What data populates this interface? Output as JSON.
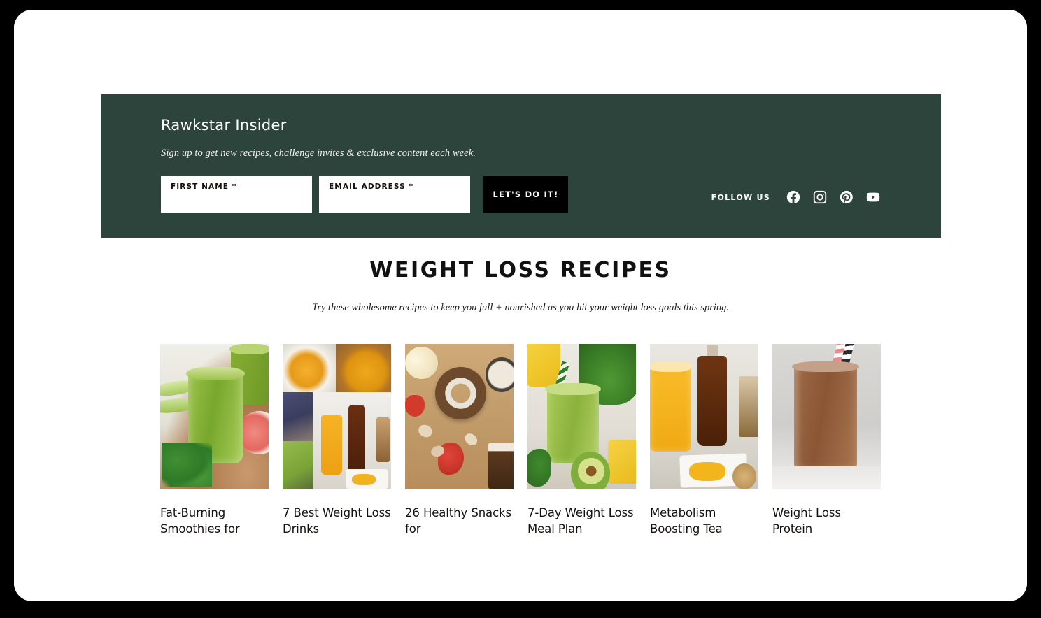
{
  "newsletter": {
    "title": "Rawkstar Insider",
    "subtitle": "Sign up to get new recipes, challenge invites & exclusive content each week.",
    "first_name_label": "FIRST NAME *",
    "first_name_value": "",
    "first_name_placeholder": "",
    "email_label": "EMAIL ADDRESS *",
    "email_value": "",
    "email_placeholder": "",
    "submit_label": "LET'S DO IT!",
    "background_color": "#2d443d",
    "button_color": "#000000"
  },
  "follow": {
    "label": "FOLLOW US",
    "socials": [
      {
        "name": "facebook-icon",
        "label": "Facebook"
      },
      {
        "name": "instagram-icon",
        "label": "Instagram"
      },
      {
        "name": "pinterest-icon",
        "label": "Pinterest"
      },
      {
        "name": "youtube-icon",
        "label": "YouTube"
      }
    ]
  },
  "recipes": {
    "heading": "WEIGHT LOSS RECIPES",
    "subheading": "Try these wholesome recipes to keep you full + nourished as you hit your weight loss goals this spring.",
    "cards": [
      {
        "title": "Fat-Burning Smoothies for",
        "image_alt": "green smoothie in mason jars with mint, celery and grapefruit"
      },
      {
        "title": "7 Best Weight Loss Drinks",
        "image_alt": "collage of turmeric drinks, blueberry smoothie and green smoothie"
      },
      {
        "title": "26 Healthy Snacks for",
        "image_alt": "coconut donut, strawberries and almonds on a wooden board"
      },
      {
        "title": "7-Day Weight Loss Meal Plan",
        "image_alt": "green smoothie with spinach, pineapple and avocado"
      },
      {
        "title": "Metabolism Boosting Tea",
        "image_alt": "jars of turmeric tea and dark brewed tea with fresh ginger"
      },
      {
        "title": "Weight Loss Protein",
        "image_alt": "chocolate protein shake in a glass with striped straws"
      }
    ]
  }
}
